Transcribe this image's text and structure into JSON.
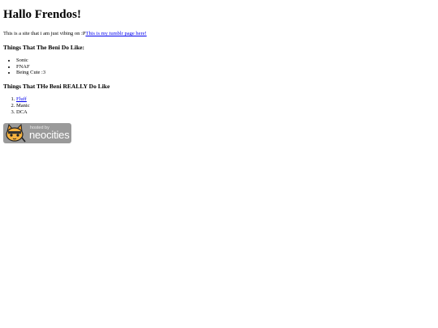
{
  "heading": "Hallo Frendos!",
  "intro": {
    "text": "This is a site that i am just vibing on :P",
    "link_text": "This is my tumblr page here!"
  },
  "likes": {
    "title": "Things That The Beni Do Like:",
    "items": [
      "Sonic",
      "FNAF",
      "Being Cute :3"
    ]
  },
  "really_likes": {
    "title": "Things That THe Beni REALLY Do Like",
    "items": [
      {
        "label": "Fluff",
        "is_link": true
      },
      {
        "label": "Manic",
        "is_link": false
      },
      {
        "label": "DCA",
        "is_link": false
      }
    ]
  },
  "badge": {
    "small_text": "hosted by",
    "big_text": "neocities",
    "icon": "neocities-cat-icon",
    "background": "#9a9a9a"
  },
  "colors": {
    "link": "#0000ee",
    "text": "#000000",
    "background": "#ffffff"
  }
}
